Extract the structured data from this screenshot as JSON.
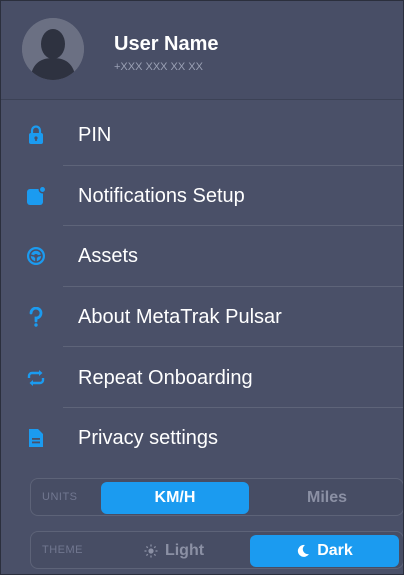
{
  "profile": {
    "name": "User Name",
    "phone": "+XXX XXX XX XX"
  },
  "menu": {
    "items": [
      {
        "label": "PIN",
        "icon": "lock-icon"
      },
      {
        "label": "Notifications Setup",
        "icon": "notification-icon"
      },
      {
        "label": "Assets",
        "icon": "steering-wheel-icon"
      },
      {
        "label": "About MetaTrak Pulsar",
        "icon": "question-icon"
      },
      {
        "label": "Repeat Onboarding",
        "icon": "repeat-icon"
      },
      {
        "label": "Privacy settings",
        "icon": "document-icon"
      }
    ]
  },
  "units": {
    "caption": "UNITS",
    "options": [
      "KM/H",
      "Miles"
    ],
    "selected": "KM/H"
  },
  "theme": {
    "caption": "THEME",
    "options": [
      "Light",
      "Dark"
    ],
    "selected": "Dark"
  },
  "colors": {
    "background": "#4a5068",
    "accent": "#1b9bf0",
    "text": "#ffffff"
  }
}
